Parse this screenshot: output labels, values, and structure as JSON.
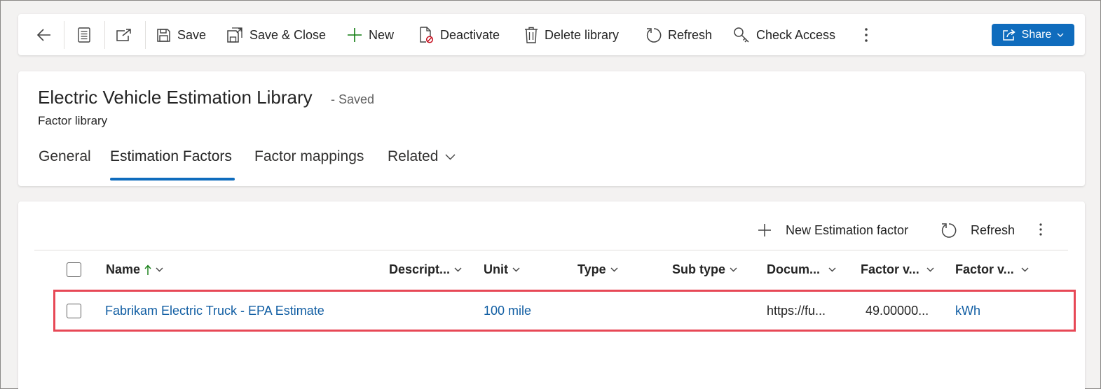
{
  "command_bar": {
    "back_icon": "back-arrow-icon",
    "form_icon": "form-icon",
    "popout_icon": "open-in-new-window-icon",
    "save": "Save",
    "save_close": "Save & Close",
    "new": "New",
    "deactivate": "Deactivate",
    "delete": "Delete library",
    "refresh": "Refresh",
    "check_access": "Check Access",
    "share": "Share"
  },
  "header": {
    "title": "Electric Vehicle Estimation Library",
    "status": "- Saved",
    "entity": "Factor library",
    "tabs": [
      {
        "label": "General"
      },
      {
        "label": "Estimation Factors",
        "active": true
      },
      {
        "label": "Factor mappings"
      },
      {
        "label": "Related"
      }
    ]
  },
  "grid": {
    "toolbar": {
      "new_label": "New Estimation factor",
      "refresh_label": "Refresh"
    },
    "columns": [
      {
        "label": "Name",
        "sort": "ascending"
      },
      {
        "label": "Descript..."
      },
      {
        "label": "Unit"
      },
      {
        "label": "Type"
      },
      {
        "label": "Sub type"
      },
      {
        "label": "Docum..."
      },
      {
        "label": "Factor v..."
      },
      {
        "label": "Factor v..."
      }
    ],
    "rows": [
      {
        "name": "Fabrikam Electric Truck - EPA Estimate",
        "description": "",
        "unit": "100 mile",
        "type": "",
        "sub_type": "",
        "documentation": "https://fu...",
        "factor_value": "49.00000...",
        "factor_value_unit": "kWh"
      }
    ]
  },
  "colors": {
    "accent": "#0f6cbd",
    "link": "#115ea3",
    "highlight": "#e74856",
    "add_icon": "#107c10"
  }
}
